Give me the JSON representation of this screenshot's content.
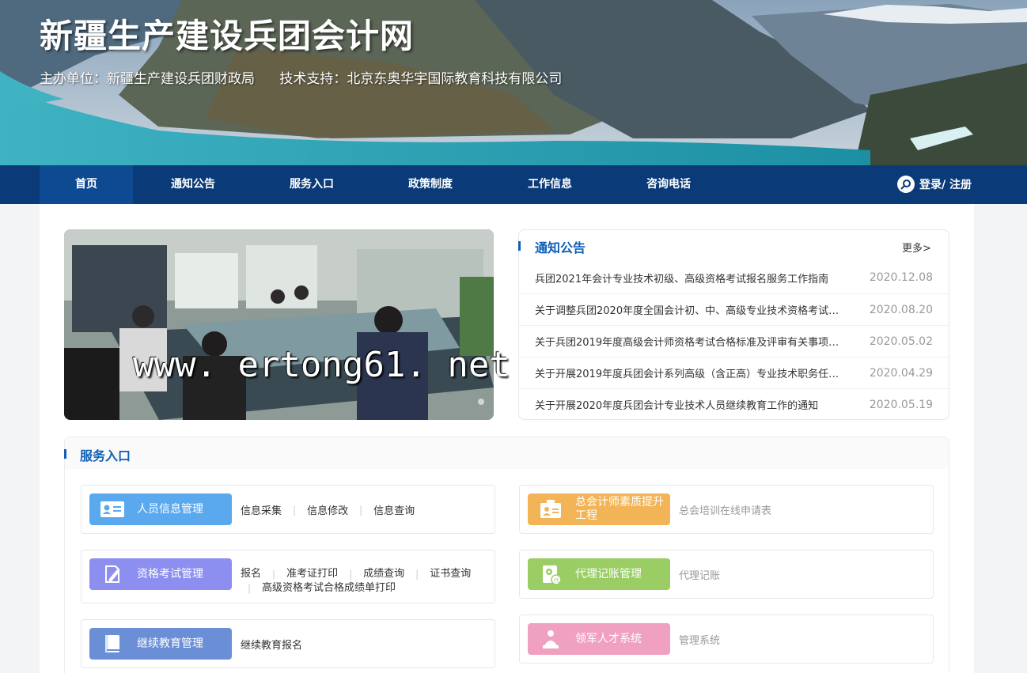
{
  "header": {
    "title": "新疆生产建设兵团会计网",
    "host": "主办单位：新疆生产建设兵团财政局",
    "support": "技术支持：北京东奥华宇国际教育科技有限公司"
  },
  "nav": {
    "items": [
      "首页",
      "通知公告",
      "服务入口",
      "政策制度",
      "工作信息",
      "咨询电话"
    ],
    "active": 0,
    "login": "登录/ 注册"
  },
  "carousel": {
    "watermark": "www. ertong61. net"
  },
  "notice": {
    "title": "通知公告",
    "more": "更多>",
    "items": [
      {
        "text": "兵团2021年会计专业技术初级、高级资格考试报名服务工作指南",
        "date": "2020.12.08"
      },
      {
        "text": "关于调整兵团2020年度全国会计初、中、高级专业技术资格考试…",
        "date": "2020.08.20"
      },
      {
        "text": "关于兵团2019年度高级会计师资格考试合格标准及评审有关事项…",
        "date": "2020.05.02"
      },
      {
        "text": "关于开展2019年度兵团会计系列高级（含正高）专业技术职务任…",
        "date": "2020.04.29"
      },
      {
        "text": "关于开展2020年度兵团会计专业技术人员继续教育工作的通知",
        "date": "2020.05.19"
      }
    ]
  },
  "service": {
    "title": "服务入口",
    "cards": [
      {
        "label": "人员信息管理",
        "icon": "id-card-icon",
        "color": "#5aa9ef",
        "links": [
          "信息采集",
          "信息修改",
          "信息查询"
        ]
      },
      {
        "label": "总会计师素质提升工程",
        "icon": "badge-icon",
        "color": "#f2b456",
        "links": [
          "总会培训在线申请表"
        ]
      },
      {
        "label": "资格考试管理",
        "icon": "pen-icon",
        "color": "#8d8ff0",
        "links": [
          "报名",
          "准考证打印",
          "成绩查询",
          "证书查询",
          "高级资格考试合格成绩单打印"
        ]
      },
      {
        "label": "代理记账管理",
        "icon": "gear-doc-icon",
        "color": "#9acd63",
        "links": [
          "代理记账"
        ]
      },
      {
        "label": "继续教育管理",
        "icon": "book-icon",
        "color": "#6b8fd6",
        "links": [
          "继续教育报名"
        ]
      },
      {
        "label": "领军人才系统",
        "icon": "person-icon",
        "color": "#f0a0c0",
        "links": [
          "管理系统"
        ]
      }
    ]
  }
}
